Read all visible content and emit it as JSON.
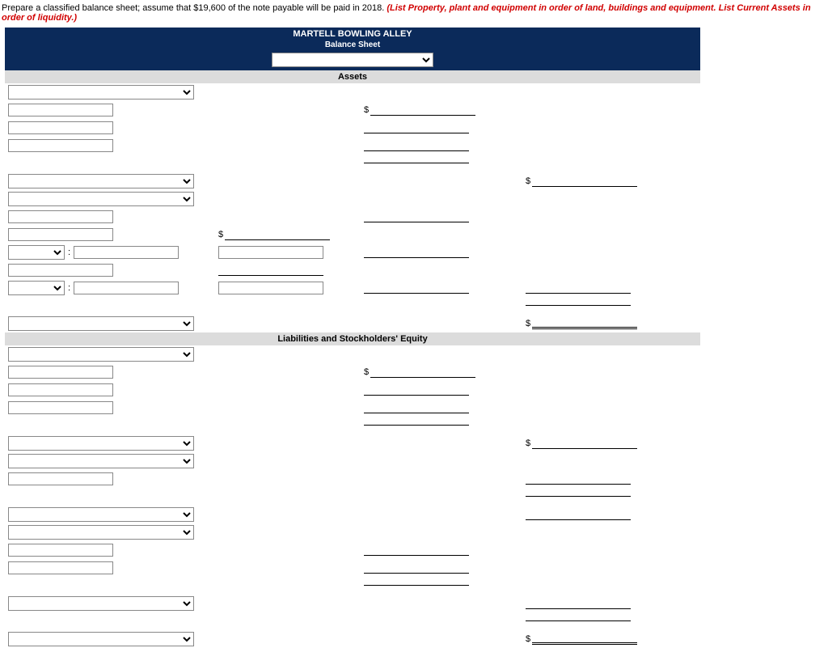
{
  "instruction": {
    "prefix": "Prepare a classified balance sheet; assume that $19,600 of the note payable will be paid in 2018. ",
    "highlight": "(List Property, plant and equipment in order of land, buildings and equipment. List Current Assets in order of liquidity.)"
  },
  "header": {
    "company": "MARTELL BOWLING ALLEY",
    "title": "Balance Sheet"
  },
  "sections": {
    "assets": "Assets",
    "liab_equity": "Liabilities and Stockholders' Equity"
  },
  "currency": "$"
}
